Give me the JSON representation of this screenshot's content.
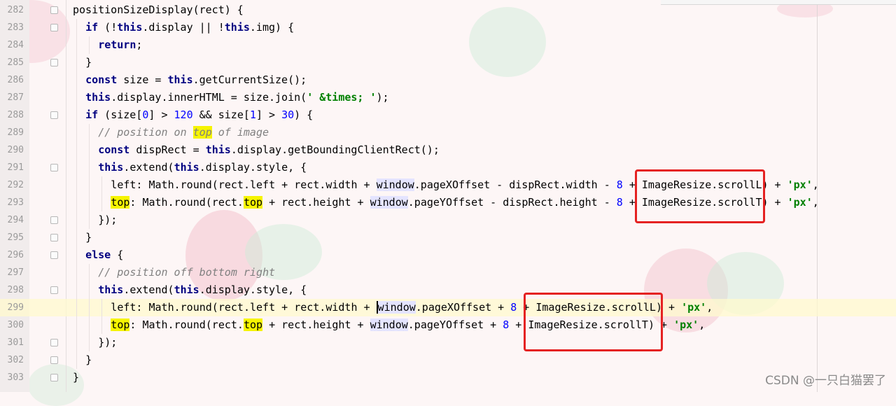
{
  "editor": {
    "lines": [
      {
        "n": "282",
        "indent": 0,
        "fold": true,
        "segs": [
          [
            "t",
            "positionSizeDisplay(rect) {"
          ]
        ]
      },
      {
        "n": "283",
        "indent": 1,
        "fold": true,
        "segs": [
          [
            "k",
            "if"
          ],
          [
            "t",
            " (!"
          ],
          [
            "k",
            "this"
          ],
          [
            "t",
            ".display || !"
          ],
          [
            "k",
            "this"
          ],
          [
            "t",
            ".img) {"
          ]
        ]
      },
      {
        "n": "284",
        "indent": 2,
        "segs": [
          [
            "k",
            "return"
          ],
          [
            "t",
            ";"
          ]
        ]
      },
      {
        "n": "285",
        "indent": 1,
        "fold": true,
        "segs": [
          [
            "t",
            "}"
          ]
        ]
      },
      {
        "n": "286",
        "indent": 1,
        "segs": [
          [
            "k",
            "const"
          ],
          [
            "t",
            " size = "
          ],
          [
            "k",
            "this"
          ],
          [
            "t",
            ".getCurrentSize();"
          ]
        ]
      },
      {
        "n": "287",
        "indent": 1,
        "segs": [
          [
            "k",
            "this"
          ],
          [
            "t",
            ".display.innerHTML = size.join("
          ],
          [
            "s",
            "' &times; '"
          ],
          [
            "t",
            ");"
          ]
        ]
      },
      {
        "n": "288",
        "indent": 1,
        "fold": true,
        "segs": [
          [
            "k",
            "if"
          ],
          [
            "t",
            " (size["
          ],
          [
            "n",
            "0"
          ],
          [
            "t",
            "] > "
          ],
          [
            "n",
            "120"
          ],
          [
            "t",
            " && size["
          ],
          [
            "n",
            "1"
          ],
          [
            "t",
            "] > "
          ],
          [
            "n",
            "30"
          ],
          [
            "t",
            ") {"
          ]
        ]
      },
      {
        "n": "289",
        "indent": 2,
        "segs": [
          [
            "c",
            "// position on "
          ],
          [
            "ch",
            "top"
          ],
          [
            "c",
            " of image"
          ]
        ]
      },
      {
        "n": "290",
        "indent": 2,
        "segs": [
          [
            "k",
            "const"
          ],
          [
            "t",
            " dispRect = "
          ],
          [
            "k",
            "this"
          ],
          [
            "t",
            ".display.getBoundingClientRect();"
          ]
        ]
      },
      {
        "n": "291",
        "indent": 2,
        "fold": true,
        "segs": [
          [
            "k",
            "this"
          ],
          [
            "t",
            ".extend("
          ],
          [
            "k",
            "this"
          ],
          [
            "t",
            ".display.style, {"
          ]
        ]
      },
      {
        "n": "292",
        "indent": 3,
        "segs": [
          [
            "t",
            "left: Math.round(rect.left + rect.width + "
          ],
          [
            "w",
            "window"
          ],
          [
            "t",
            ".pageXOffset - dispRect.width - "
          ],
          [
            "n",
            "8"
          ],
          [
            "t",
            " + ImageResize.scrollL) + "
          ],
          [
            "s",
            "'px'"
          ],
          [
            "t",
            ","
          ]
        ]
      },
      {
        "n": "293",
        "indent": 3,
        "segs": [
          [
            "h",
            "top"
          ],
          [
            "t",
            ": Math.round(rect."
          ],
          [
            "h",
            "top"
          ],
          [
            "t",
            " + rect.height + "
          ],
          [
            "w",
            "window"
          ],
          [
            "t",
            ".pageYOffset - dispRect.height - "
          ],
          [
            "n",
            "8"
          ],
          [
            "t",
            " + ImageResize.scrollT) + "
          ],
          [
            "s",
            "'px'"
          ],
          [
            "t",
            ","
          ]
        ]
      },
      {
        "n": "294",
        "indent": 2,
        "fold": true,
        "segs": [
          [
            "t",
            "});"
          ]
        ]
      },
      {
        "n": "295",
        "indent": 1,
        "fold": true,
        "segs": [
          [
            "t",
            "}"
          ]
        ]
      },
      {
        "n": "296",
        "indent": 1,
        "fold": true,
        "segs": [
          [
            "k",
            "else"
          ],
          [
            "t",
            " {"
          ]
        ]
      },
      {
        "n": "297",
        "indent": 2,
        "segs": [
          [
            "c",
            "// position off bottom right"
          ]
        ]
      },
      {
        "n": "298",
        "indent": 2,
        "fold": true,
        "segs": [
          [
            "k",
            "this"
          ],
          [
            "t",
            ".extend("
          ],
          [
            "k",
            "this"
          ],
          [
            "t",
            ".display.style, {"
          ]
        ]
      },
      {
        "n": "299",
        "indent": 3,
        "current": true,
        "segs": [
          [
            "t",
            "left: Math.round(rect.left + rect.width + "
          ],
          [
            "wc",
            "window"
          ],
          [
            "t",
            ".pageXOffset + "
          ],
          [
            "n",
            "8"
          ],
          [
            "t",
            " + ImageResize.scrollL) + "
          ],
          [
            "s",
            "'px'"
          ],
          [
            "t",
            ","
          ]
        ]
      },
      {
        "n": "300",
        "indent": 3,
        "segs": [
          [
            "h",
            "top"
          ],
          [
            "t",
            ": Math.round(rect."
          ],
          [
            "h",
            "top"
          ],
          [
            "t",
            " + rect.height + "
          ],
          [
            "w",
            "window"
          ],
          [
            "t",
            ".pageYOffset + "
          ],
          [
            "n",
            "8"
          ],
          [
            "t",
            " + ImageResize.scrollT) + "
          ],
          [
            "s",
            "'px'"
          ],
          [
            "t",
            ","
          ]
        ]
      },
      {
        "n": "301",
        "indent": 2,
        "fold": true,
        "segs": [
          [
            "t",
            "});"
          ]
        ]
      },
      {
        "n": "302",
        "indent": 1,
        "fold": true,
        "segs": [
          [
            "t",
            "}"
          ]
        ]
      },
      {
        "n": "303",
        "indent": 0,
        "fold": true,
        "segs": [
          [
            "t",
            "}"
          ]
        ]
      }
    ]
  },
  "watermark": "CSDN @一只白猫罢了",
  "colors": {
    "keyword": "#000080",
    "number": "#0000ff",
    "string": "#008000",
    "comment": "#808080",
    "search_highlight": "#f6f400",
    "annotation_box": "#e52222",
    "current_line": "#fffacd"
  }
}
